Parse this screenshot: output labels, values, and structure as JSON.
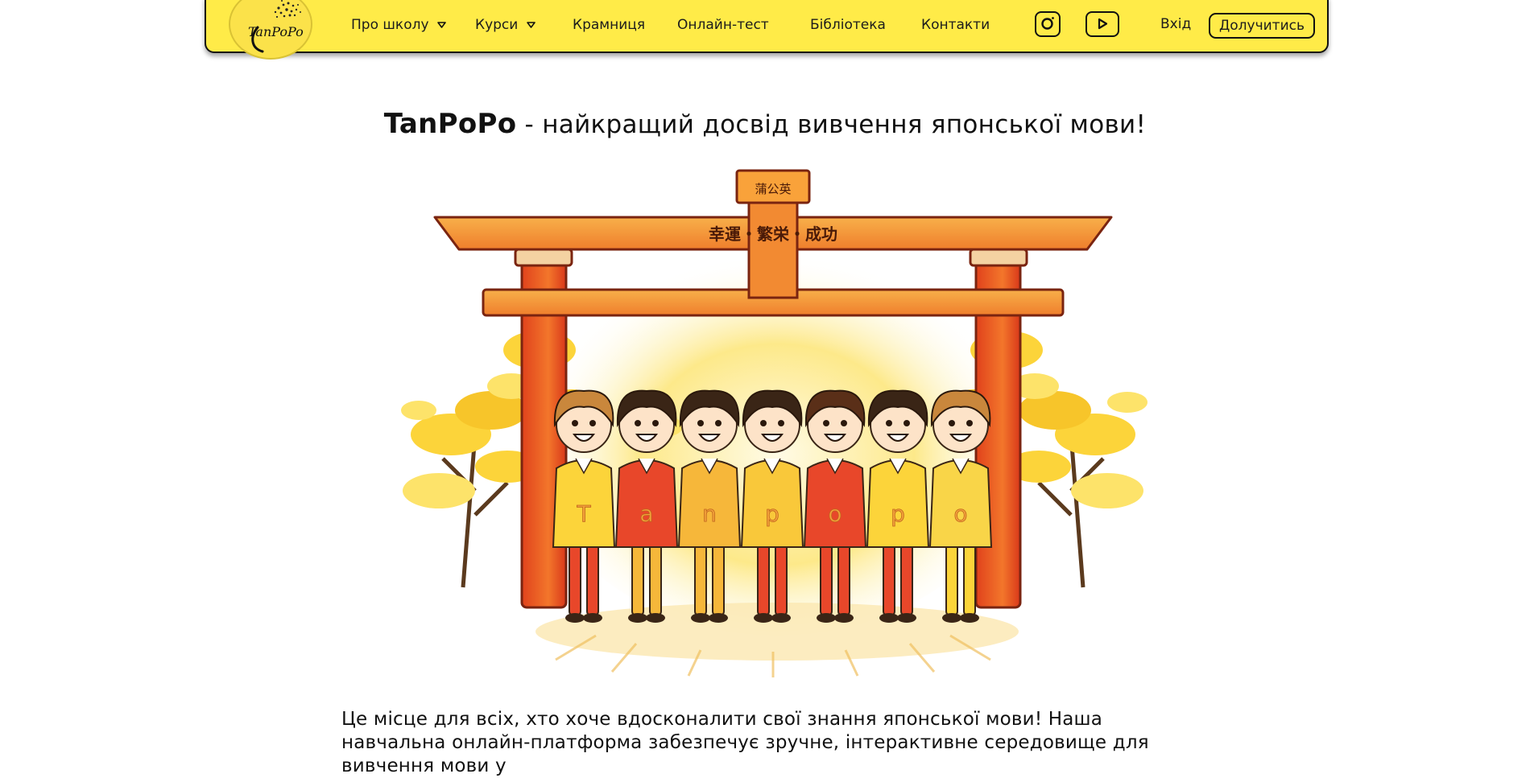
{
  "header": {
    "logo_text": "TanPoPo",
    "nav": [
      {
        "label": "Про школу",
        "has_dropdown": true
      },
      {
        "label": "Курси",
        "has_dropdown": true
      },
      {
        "label": "Крамниця",
        "has_dropdown": false
      },
      {
        "label": "Онлайн-тест",
        "has_dropdown": false
      },
      {
        "label": "Бібліотека",
        "has_dropdown": false
      },
      {
        "label": "Контакти",
        "has_dropdown": false
      }
    ],
    "social": [
      "instagram-icon",
      "youtube-icon"
    ],
    "login_label": "Вхід",
    "join_label": "Долучитись",
    "accent_color": "#ffeb48"
  },
  "hero": {
    "brand": "TanPoPo",
    "headline_rest": " - найкращий досвід вивчення японської мови!",
    "illustration": {
      "gate_top_sign": "蒲公英",
      "gate_beam_text": "幸運・繁栄・成功",
      "shirt_letters": [
        "T",
        "a",
        "n",
        "p",
        "o",
        "p",
        "o"
      ]
    },
    "intro_text": "Це місце для всіх, хто хоче вдосконалити свої знання японської мови! Наша навчальна онлайн-платформа забезпечує зручне, інтерактивне середовище для вивчення мови у"
  }
}
